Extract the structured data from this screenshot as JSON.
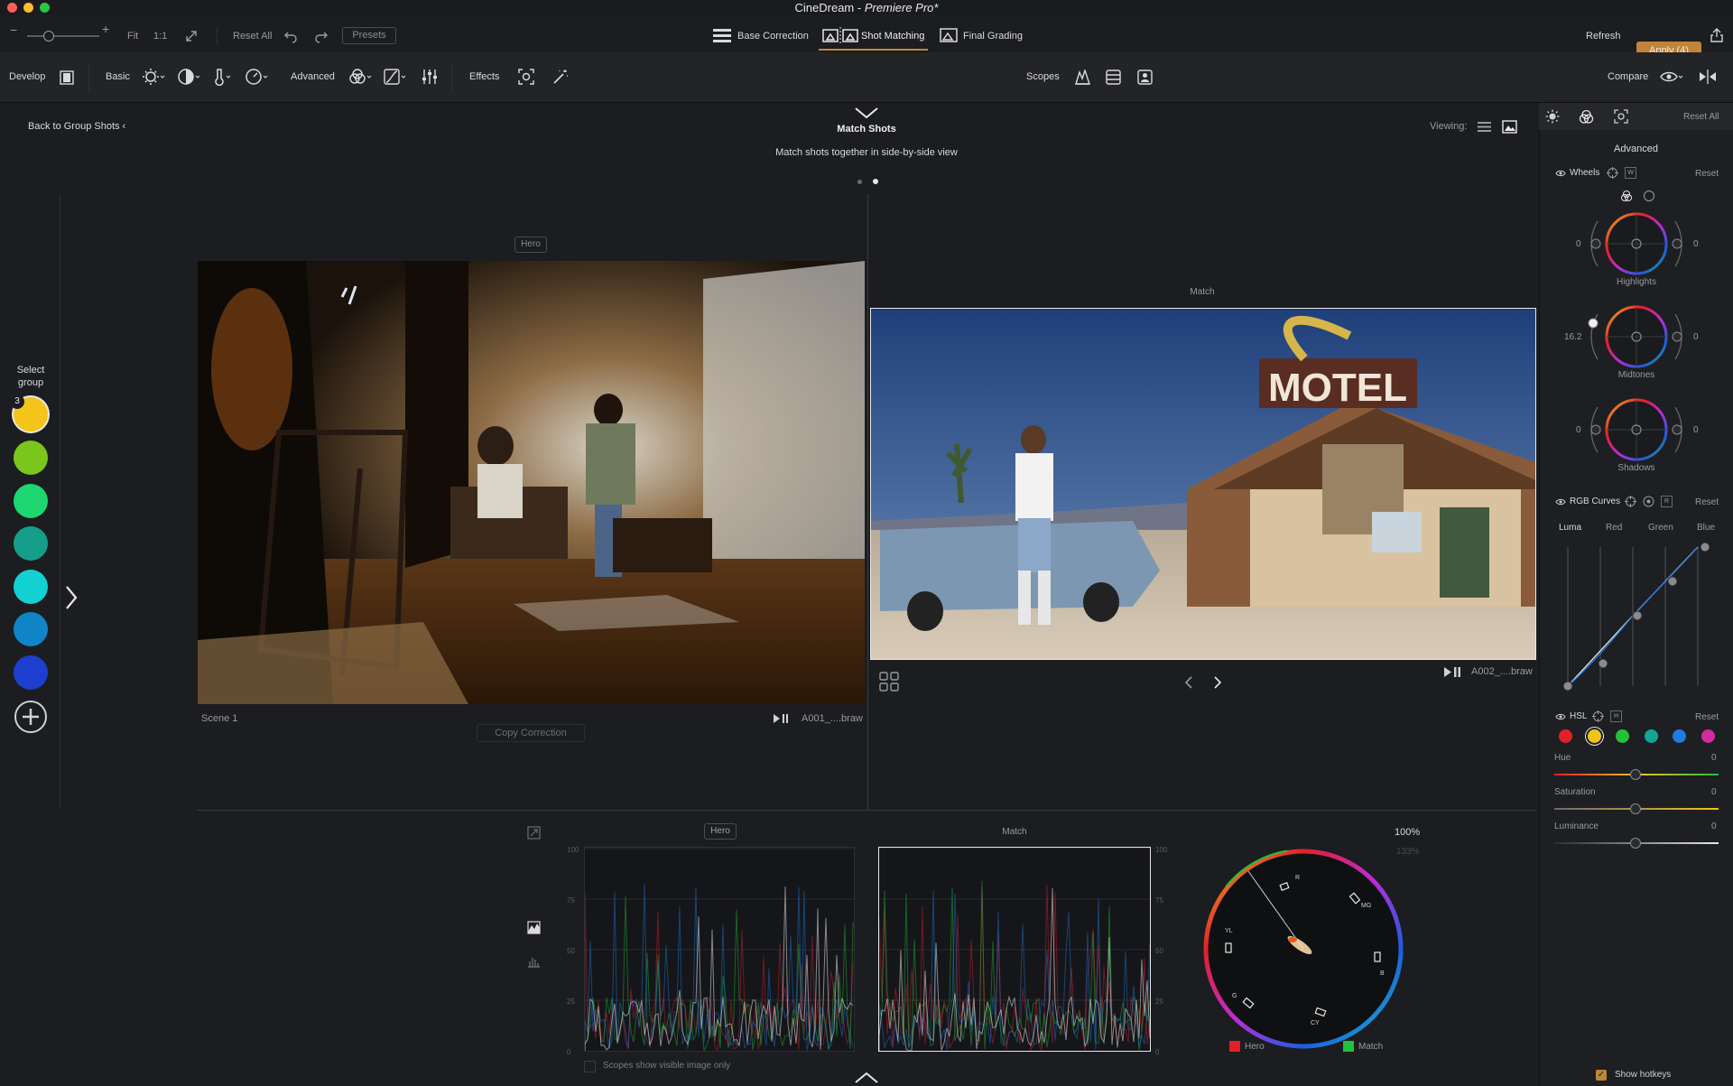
{
  "app": {
    "title": "CineDream",
    "subtitle": "Premiere Pro*"
  },
  "toolbar": {
    "zoom_fit": "Fit",
    "zoom_1to1": "1:1",
    "reset_all": "Reset All",
    "presets": "Presets",
    "refresh": "Refresh",
    "apply": "Apply (4)"
  },
  "workflow_tabs": [
    {
      "label": "Base Correction"
    },
    {
      "label": "Shot Matching"
    },
    {
      "label": "Final Grading"
    }
  ],
  "panels": {
    "develop": "Develop",
    "basic": "Basic",
    "advanced": "Advanced",
    "effects": "Effects",
    "scopes": "Scopes",
    "compare": "Compare"
  },
  "header": {
    "back": "Back to Group Shots",
    "title": "Match Shots",
    "subtitle": "Match shots together in side-by-side view",
    "viewing": "Viewing:"
  },
  "groups": {
    "label_line1": "Select",
    "label_line2": "group",
    "badge": "3",
    "colors": [
      "#f4c41a",
      "#7bc61d",
      "#1ed66f",
      "#159e8a",
      "#13d0d2",
      "#0f85c8",
      "#1d3fcf"
    ]
  },
  "hero": {
    "tag": "Hero",
    "scene": "Scene 1",
    "file": "A001_....braw",
    "copy": "Copy Correction"
  },
  "match": {
    "tag": "Match",
    "file": "A002_....braw"
  },
  "scopes": {
    "hero_tag": "Hero",
    "match_tag": "Match",
    "y_ticks": [
      "100",
      "75",
      "50",
      "25",
      "0"
    ],
    "zoom": "100%",
    "zoom_alt": "133%",
    "visible_only": "Scopes show visible image only",
    "vector_labels": [
      "R",
      "MG",
      "YL",
      "B",
      "G",
      "CY"
    ],
    "legend_hero": "Hero",
    "legend_match": "Match",
    "color_hero": "#e3202a",
    "color_match": "#22c13a"
  },
  "right_panel": {
    "reset_all": "Reset All",
    "section": "Advanced",
    "wheels": {
      "label": "Wheels",
      "key": "W",
      "reset": "Reset",
      "items": [
        {
          "name": "Highlights",
          "left": "0",
          "right": "0"
        },
        {
          "name": "Midtones",
          "left": "16.2",
          "right": "0"
        },
        {
          "name": "Shadows",
          "left": "0",
          "right": "0"
        }
      ]
    },
    "curves": {
      "label": "RGB Curves",
      "key": "R",
      "reset": "Reset",
      "channels": [
        "Luma",
        "Red",
        "Green",
        "Blue"
      ]
    },
    "hsl": {
      "label": "HSL",
      "key": "H",
      "reset": "Reset",
      "colors": [
        "#e2202a",
        "#f0c419",
        "#22c13a",
        "#14a596",
        "#1e7de0",
        "#d42b9e"
      ],
      "sliders": [
        {
          "name": "Hue",
          "value": "0"
        },
        {
          "name": "Saturation",
          "value": "0"
        },
        {
          "name": "Luminance",
          "value": "0"
        }
      ]
    },
    "hotkeys": "Show hotkeys"
  }
}
